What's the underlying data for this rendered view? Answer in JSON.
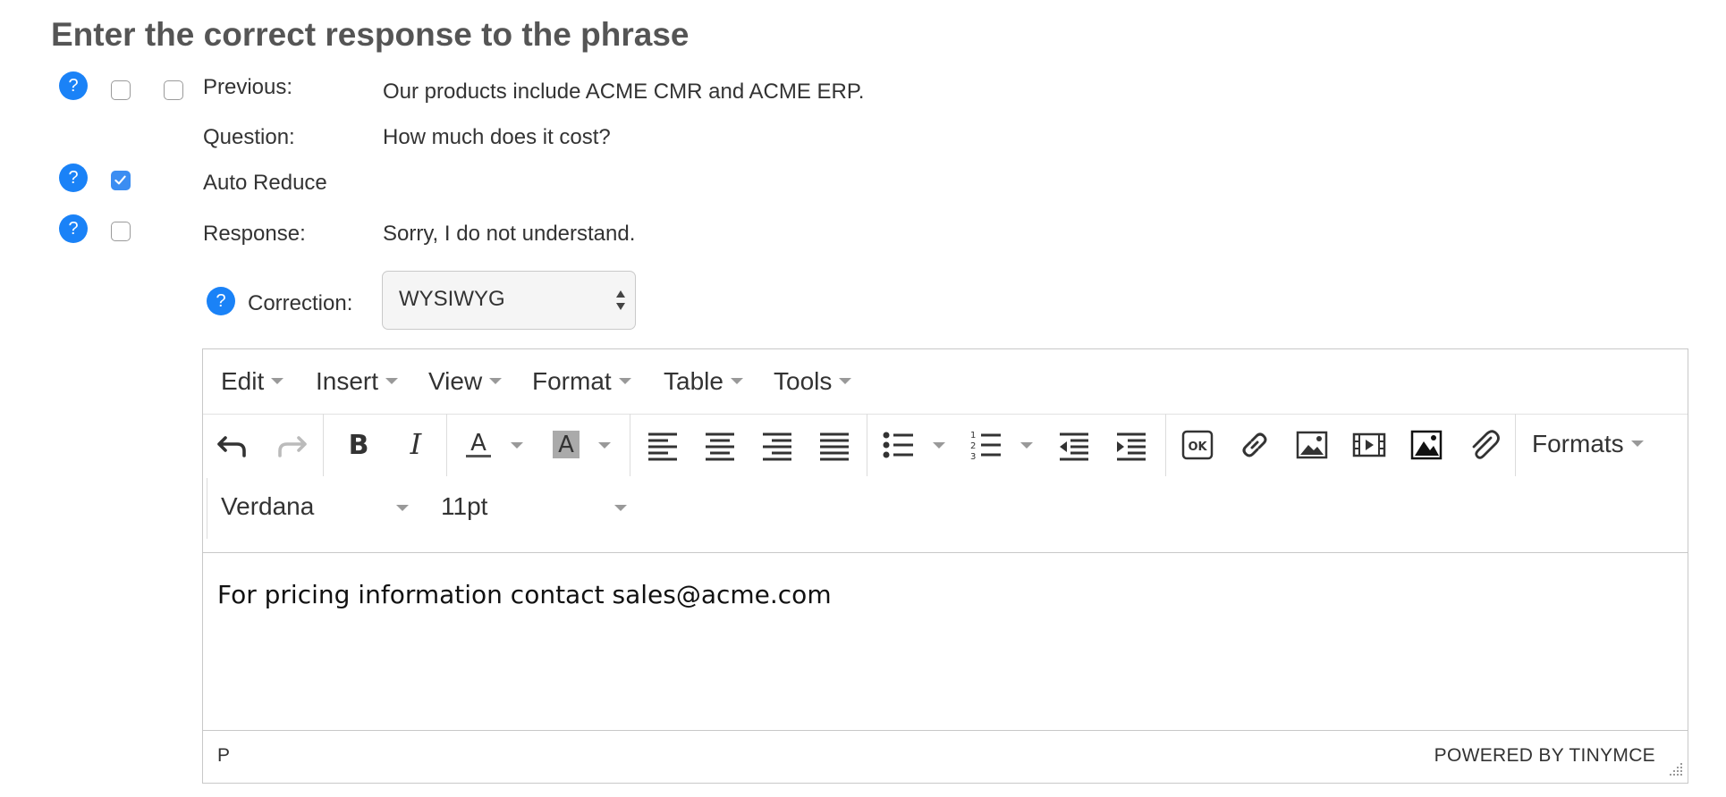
{
  "title": "Enter the correct response to the phrase",
  "help_symbol": "?",
  "rows": {
    "previous": {
      "label": "Previous:",
      "value": "Our products include ACME CMR and ACME ERP.",
      "checkbox_a": false,
      "checkbox_b": false
    },
    "question": {
      "label": "Question:",
      "value": "How much does it cost?"
    },
    "auto_reduce": {
      "label": "Auto Reduce",
      "checked": true
    },
    "response": {
      "label": "Response:",
      "value": "Sorry, I do not understand.",
      "checked": false
    }
  },
  "correction": {
    "label": "Correction:",
    "mode": "WYSIWYG"
  },
  "editor": {
    "menu": [
      "Edit",
      "Insert",
      "View",
      "Format",
      "Table",
      "Tools"
    ],
    "toolbar": {
      "formats_label": "Formats",
      "font_family": "Verdana",
      "font_size": "11pt",
      "icons": [
        "undo-icon",
        "redo-icon",
        "bold-icon",
        "italic-icon",
        "text-color-icon",
        "background-color-icon",
        "align-left-icon",
        "align-center-icon",
        "align-right-icon",
        "align-justify-icon",
        "bullet-list-icon",
        "numbered-list-icon",
        "outdent-icon",
        "indent-icon",
        "ok-icon",
        "link-icon",
        "image-icon",
        "media-icon",
        "image-dark-icon",
        "attachment-icon"
      ]
    },
    "content": "For pricing information contact sales@acme.com",
    "statusbar": {
      "path": "P",
      "branding": "POWERED BY TINYMCE"
    }
  },
  "colors": {
    "accent": "#1a82f7",
    "checkbox_checked": "#3b8df2",
    "title": "#555555",
    "border": "#c8c8c8"
  }
}
